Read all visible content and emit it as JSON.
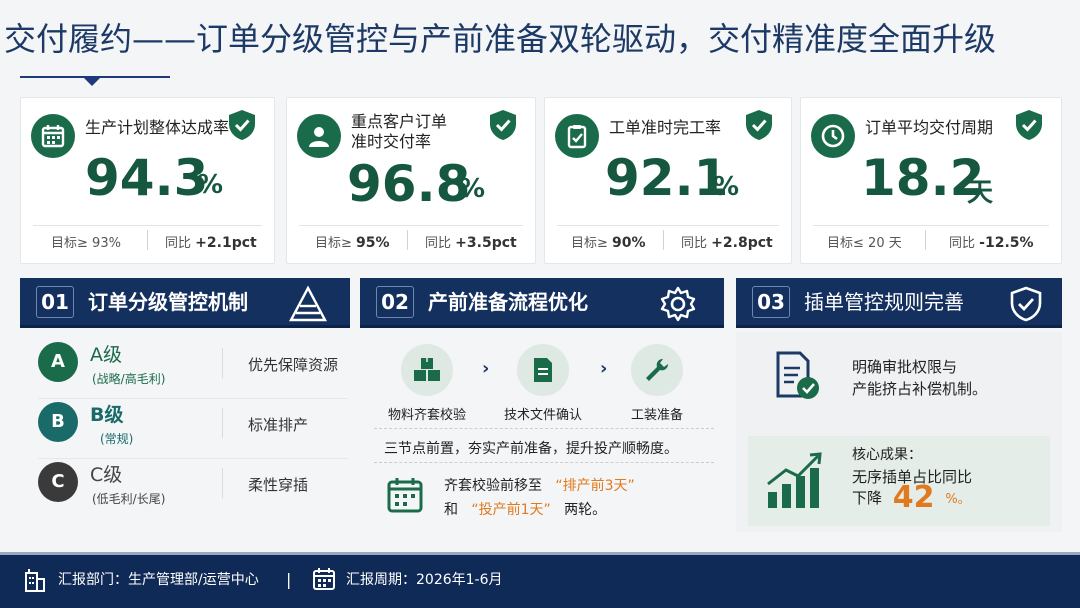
{
  "title": "交付履约——订单分级管控与产前准备双轮驱动，交付精准度全面升级",
  "kpis": [
    {
      "icon": "calendar-icon",
      "label": "生产计划整体达成率",
      "value": "94.3",
      "unit": "%",
      "target_label": "目标≥",
      "target": "93%",
      "yoy_label": "同比",
      "yoy": "+2.1pct"
    },
    {
      "icon": "person-icon",
      "label": "重点客户订单准时交付率",
      "label_line1": "重点客户订单",
      "label_line2": "准时交付率",
      "value": "96.8",
      "unit": "%",
      "target_label": "目标≥",
      "target": "95%",
      "yoy_label": "同比",
      "yoy": "+3.5pct"
    },
    {
      "icon": "clipboard-check-icon",
      "label": "工单准时完工率",
      "value": "92.1",
      "unit": "%",
      "target_label": "目标≥",
      "target": "90%",
      "yoy_label": "同比",
      "yoy": "+2.8pct"
    },
    {
      "icon": "clock-icon",
      "label": "订单平均交付周期",
      "value": "18.2",
      "unit": "天",
      "target_label": "目标≤",
      "target": "20 天",
      "yoy_label": "同比",
      "yoy": "-12.5%"
    }
  ],
  "sections": [
    {
      "num": "01",
      "title": "订单分级管控机制",
      "icon": "pyramid-icon"
    },
    {
      "num": "02",
      "title": "产前准备流程优化",
      "icon": "gear-icon"
    },
    {
      "num": "03",
      "title": "插单管控规则完善",
      "icon": "shield-check-icon"
    }
  ],
  "grades": [
    {
      "letter": "A",
      "name": "A级",
      "sub": "(战略/高毛利)",
      "desc": "优先保障资源",
      "color": "#1a6b4a"
    },
    {
      "letter": "B",
      "name": "B级",
      "sub": "(常规)",
      "desc": "标准排产",
      "color": "#1a6a6a"
    },
    {
      "letter": "C",
      "name": "C级",
      "sub": "(低毛利/长尾)",
      "desc": "柔性穿插",
      "color": "#3a3a3a"
    }
  ],
  "steps": [
    {
      "label": "物料齐套校验",
      "icon": "boxes-icon"
    },
    {
      "label": "技术文件确认",
      "icon": "document-icon"
    },
    {
      "label": "工装准备",
      "icon": "wrench-icon"
    }
  ],
  "prep_summary": "三节点前置，夯实产前准备，提升投产顺畅度。",
  "prep_note": {
    "prefix": "齐套校验前移至",
    "highlight1": "“排产前3天”",
    "mid": "和",
    "highlight2": "“投产前1天”",
    "suffix": "两轮。"
  },
  "rule_text_line1": "明确审批权限与",
  "rule_text_line2": "产能挤占补偿机制。",
  "result": {
    "label": "核心成果：",
    "line1": "无序插单占比同比",
    "line2_prefix": "下降",
    "value": "42",
    "unit": "%。"
  },
  "footer": {
    "dept": "汇报部门：生产管理部/运营中心",
    "separator": "|",
    "period": "汇报周期：2026年1-6月"
  },
  "colors": {
    "green": "#1a6b4a",
    "navy": "#14305f",
    "accent": "#e07a1f"
  }
}
